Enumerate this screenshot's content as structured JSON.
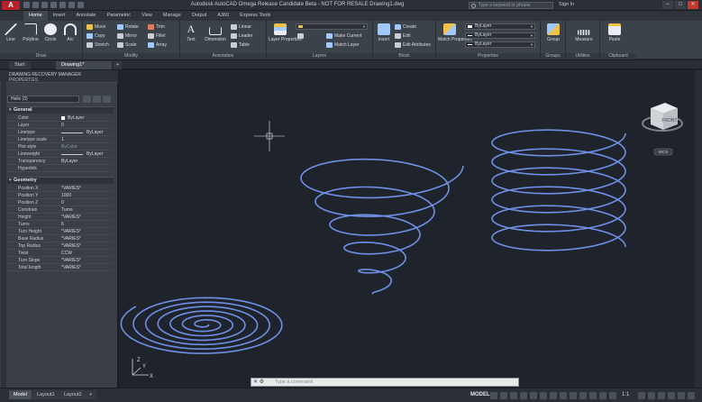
{
  "titlebar": {
    "app_button": "A",
    "title": "Autodesk AutoCAD Omega Release Candidate Beta - NOT FOR RESALE   Drawing1.dwg",
    "search_placeholder": "Type a keyword or phrase",
    "signin": "Sign In"
  },
  "ribbon_tabs": [
    "Home",
    "Insert",
    "Annotate",
    "Parametric",
    "View",
    "Manage",
    "Output",
    "A360",
    "Express Tools"
  ],
  "ribbon": {
    "draw": {
      "title": "Draw",
      "line": "Line",
      "polyline": "Polyline",
      "circle": "Circle",
      "arc": "Arc"
    },
    "modify": {
      "title": "Modify",
      "move": "Move",
      "rotate": "Rotate",
      "trim": "Trim",
      "copy": "Copy",
      "mirror": "Mirror",
      "fillet": "Fillet",
      "stretch": "Stretch",
      "scale": "Scale",
      "array": "Array"
    },
    "annotation": {
      "title": "Annotation",
      "text": "Text",
      "dimension": "Dimension",
      "linear": "Linear",
      "leader": "Leader",
      "table": "Table"
    },
    "layers": {
      "title": "Layers",
      "layer_properties": "Layer Properties",
      "make_current": "Make Current",
      "match_layer": "Match Layer"
    },
    "block": {
      "title": "Block",
      "insert": "Insert",
      "create": "Create",
      "edit": "Edit",
      "edit_attributes": "Edit Attributes"
    },
    "properties": {
      "title": "Properties",
      "match_properties": "Match Properties",
      "bylayer1": "ByLayer",
      "bylayer2": "ByLayer",
      "bylayer3": "ByLayer"
    },
    "groups": {
      "title": "Groups",
      "group": "Group"
    },
    "utilities": {
      "title": "Utilities",
      "measure": "Measure"
    },
    "clipboard": {
      "title": "Clipboard",
      "paste": "Paste"
    }
  },
  "doc_tabs": {
    "start": "Start",
    "drawing": "Drawing1*"
  },
  "palette": {
    "title": "DRAWING RECOVERY MANAGER",
    "subtitle": "PROPERTIES",
    "selection": "Helix (3)",
    "general_title": "General",
    "general": [
      {
        "k": "Color",
        "v": "ByLayer"
      },
      {
        "k": "Layer",
        "v": "0"
      },
      {
        "k": "Linetype",
        "v": "ByLayer"
      },
      {
        "k": "Linetype scale",
        "v": "1"
      },
      {
        "k": "Plot style",
        "v": "ByColor"
      },
      {
        "k": "Lineweight",
        "v": "ByLayer"
      },
      {
        "k": "Transparency",
        "v": "ByLayer"
      },
      {
        "k": "Hyperlink",
        "v": ""
      }
    ],
    "geometry_title": "Geometry",
    "geometry": [
      {
        "k": "Position X",
        "v": "*VARIES*"
      },
      {
        "k": "Position Y",
        "v": "1000"
      },
      {
        "k": "Position Z",
        "v": "0"
      },
      {
        "k": "Constrain",
        "v": "Turns"
      },
      {
        "k": "Height",
        "v": "*VARIES*"
      },
      {
        "k": "Turns",
        "v": "6"
      },
      {
        "k": "Turn Height",
        "v": "*VARIES*"
      },
      {
        "k": "Base Radius",
        "v": "*VARIES*"
      },
      {
        "k": "Top Radius",
        "v": "*VARIES*"
      },
      {
        "k": "Twist",
        "v": "CCW"
      },
      {
        "k": "Turn Slope",
        "v": "*VARIES*"
      },
      {
        "k": "Total length",
        "v": "*VARIES*"
      }
    ]
  },
  "viewcube": {
    "face": "FRONT",
    "wcs": "WCS"
  },
  "ucs": {
    "x": "X",
    "y": "Y",
    "z": "Z"
  },
  "cmdline": {
    "placeholder": "Type a command"
  },
  "status": {
    "model_tab": "Model",
    "layout1": "Layout1",
    "layout2": "Layout2",
    "add": "+",
    "model": "MODEL",
    "scale": "1:1"
  },
  "colors": {
    "helix": "#6f8fe6",
    "canvas": "#1f242c",
    "app_red": "#b6202a"
  }
}
